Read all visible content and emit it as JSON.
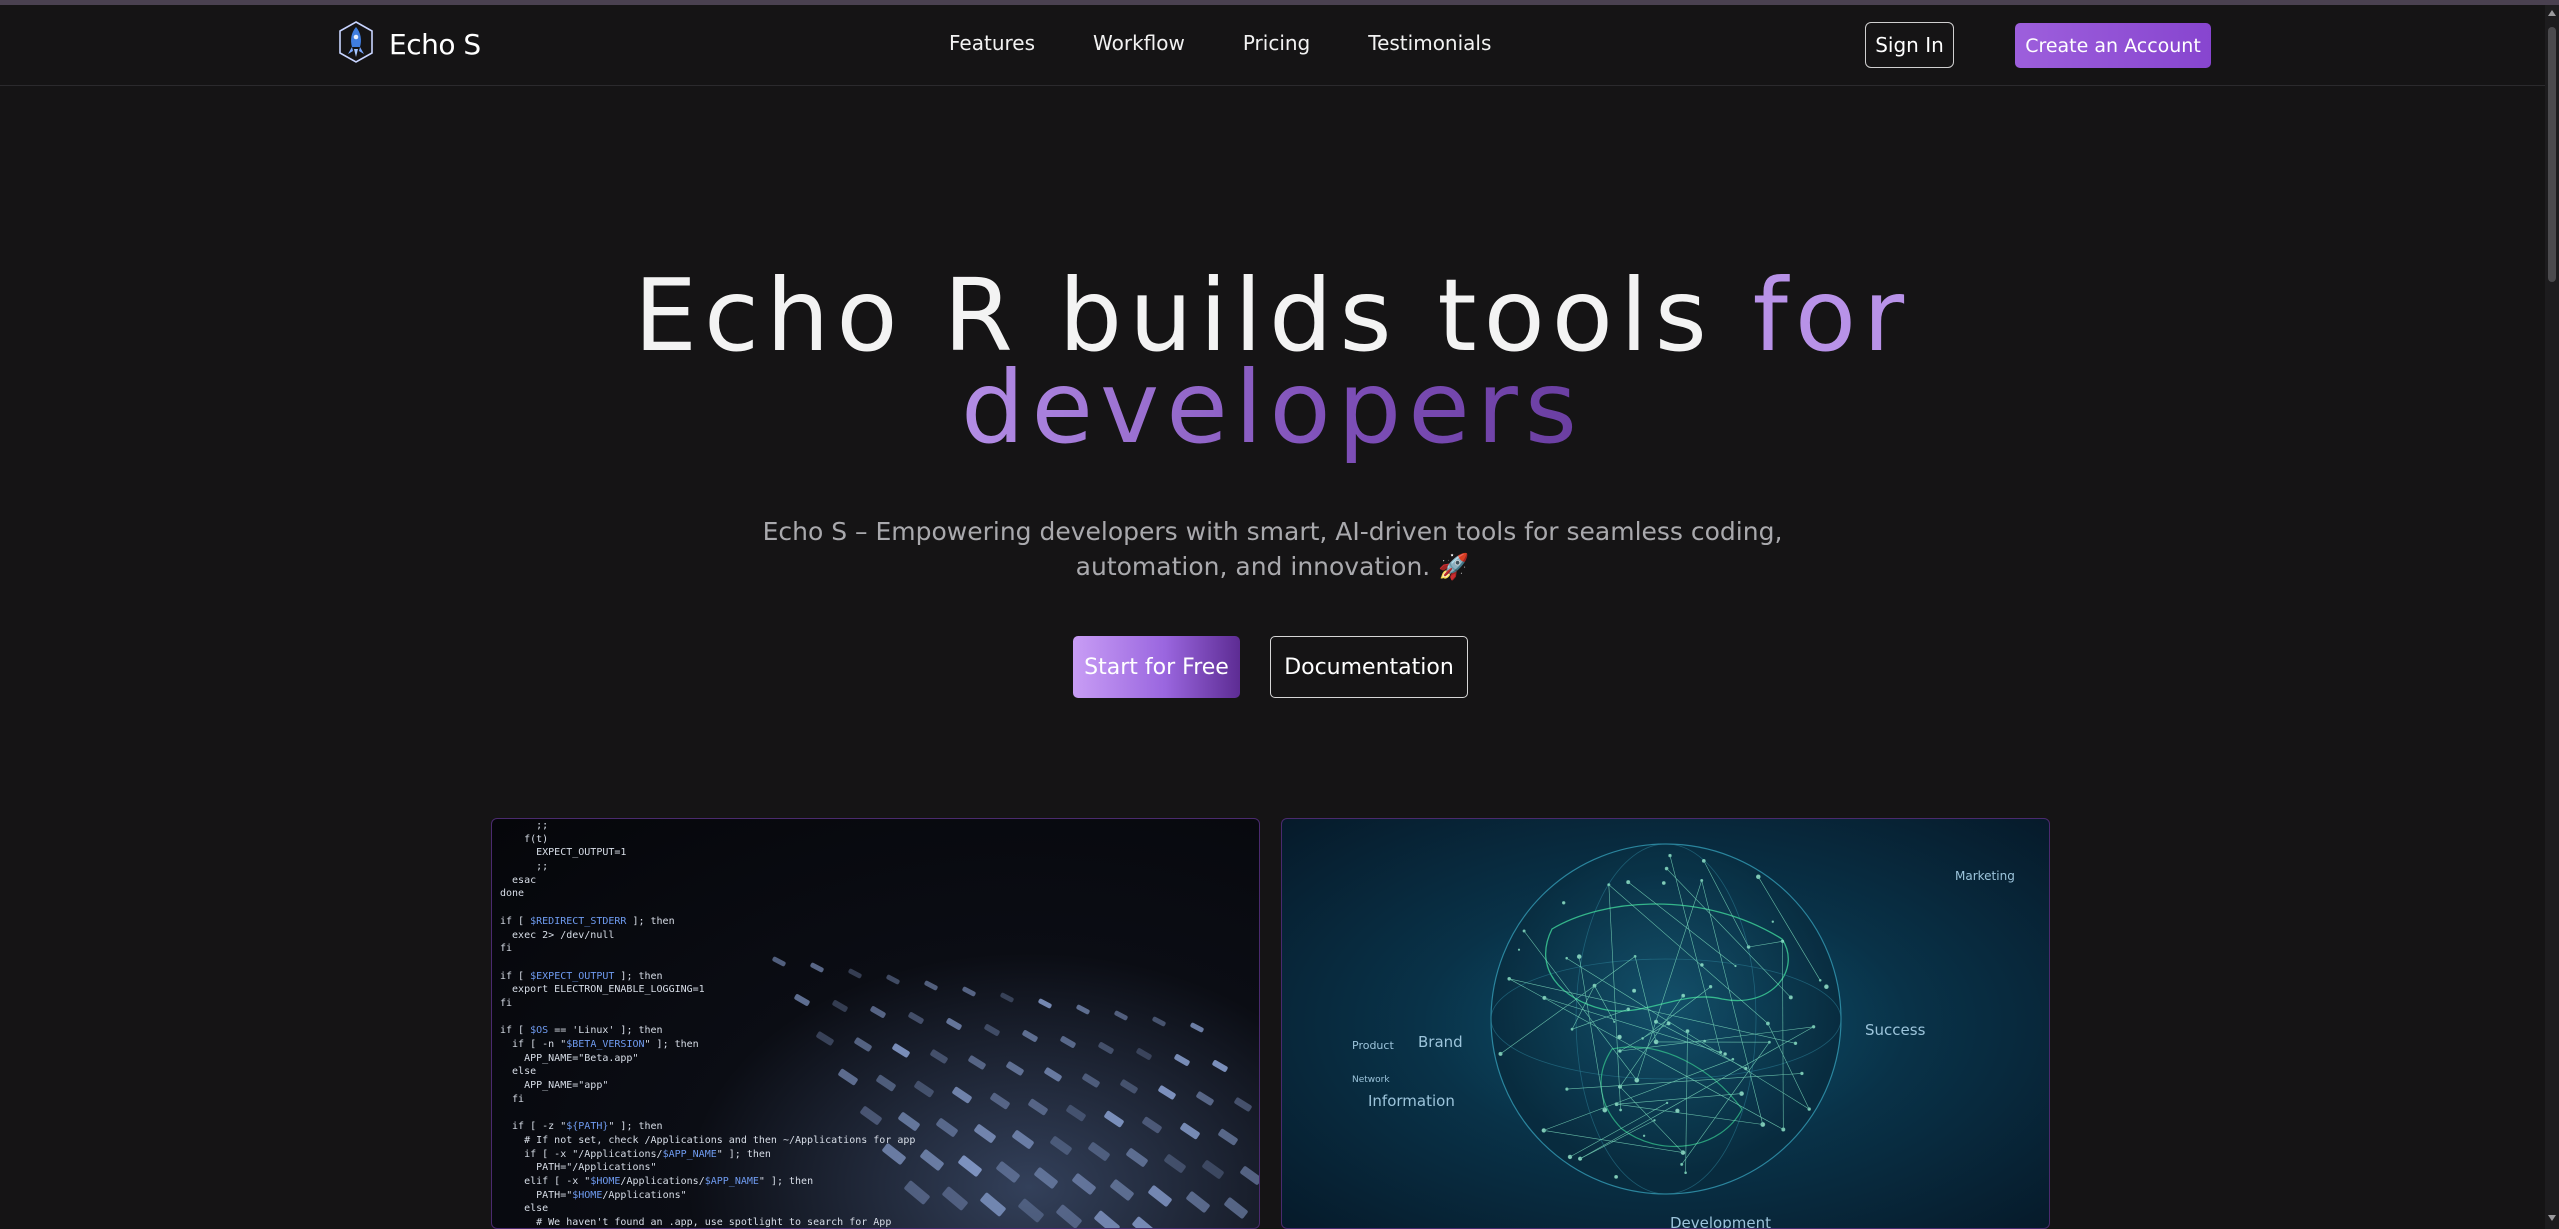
{
  "nav": {
    "brand": "Echo S",
    "logo_icon": "rocket-crystal-logo",
    "links": [
      "Features",
      "Workflow",
      "Pricing",
      "Testimonials"
    ],
    "sign_in": "Sign In",
    "create_account": "Create an Account"
  },
  "hero": {
    "title_white": "Echo R builds tools ",
    "title_purple_1": "for",
    "title_purple_2": "developers",
    "subtitle": "Echo S – Empowering developers with smart, AI-driven tools for seamless coding, automation, and innovation. 🚀",
    "start_button": "Start for Free",
    "docs_button": "Documentation"
  },
  "cards": {
    "code_lines": [
      "      ;;",
      "    f(t)",
      "      EXPECT_OUTPUT=1",
      "      ;;",
      "  esac",
      "done",
      "",
      "if [ $REDIRECT_STDERR ]; then",
      "  exec 2> /dev/null",
      "fi",
      "",
      "if [ $EXPECT_OUTPUT ]; then",
      "  export ELECTRON_ENABLE_LOGGING=1",
      "fi",
      "",
      "if [ $OS == 'Linux' ]; then",
      "  if [ -n \"$BETA_VERSION\" ]; then",
      "    APP_NAME=\"Beta.app\"",
      "  else",
      "    APP_NAME=\"app\"",
      "  fi",
      "",
      "  if [ -z \"${PATH}\" ]; then",
      "    # If not set, check /Applications and then ~/Applications for app",
      "    if [ -x \"/Applications/$APP_NAME\" ]; then",
      "      PATH=\"/Applications\"",
      "    elif [ -x \"$HOME/Applications/$APP_NAME\" ]; then",
      "      PATH=\"$HOME/Applications\"",
      "    else",
      "      # We haven't found an .app, use spotlight to search for App"
    ],
    "globe_labels": [
      "Brand",
      "Product",
      "Information",
      "Success",
      "Marketing",
      "Development",
      "Network"
    ]
  },
  "colors": {
    "background": "#151415",
    "accent_purple": "#9d5fdc",
    "title_purple": "#b892e8"
  }
}
